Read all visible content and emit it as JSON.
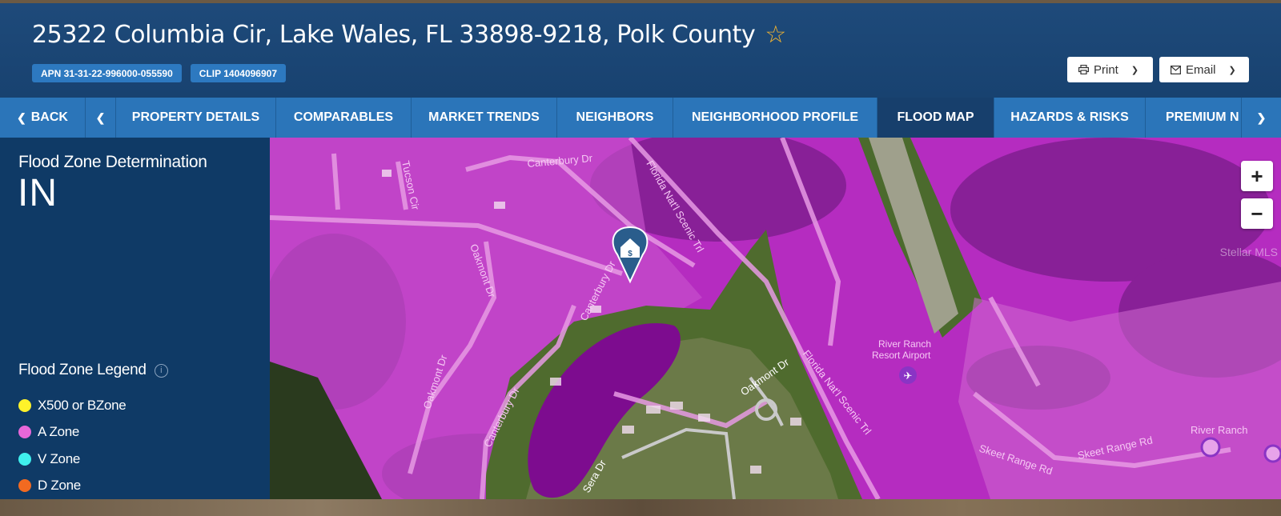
{
  "header": {
    "address": "25322 Columbia Cir, Lake Wales, FL 33898-9218, Polk County",
    "apn": "APN 31-31-22-996000-055590",
    "clip": "CLIP 1404096907",
    "print_label": "Print",
    "email_label": "Email"
  },
  "tabs": {
    "back": "BACK",
    "items": [
      "PROPERTY DETAILS",
      "COMPARABLES",
      "MARKET TRENDS",
      "NEIGHBORS",
      "NEIGHBORHOOD PROFILE",
      "FLOOD MAP",
      "HAZARDS & RISKS",
      "PREMIUM N"
    ],
    "active": "FLOOD MAP"
  },
  "sidebar": {
    "determination_title": "Flood Zone Determination",
    "determination_value": "IN",
    "legend_title": "Flood Zone Legend",
    "legend": [
      {
        "label": "X500 or BZone",
        "color": "#fff22a"
      },
      {
        "label": "A Zone",
        "color": "#e667d9"
      },
      {
        "label": "V Zone",
        "color": "#3ff0ee"
      },
      {
        "label": "D Zone",
        "color": "#f26a21"
      }
    ]
  },
  "map": {
    "zoom_in": "+",
    "zoom_out": "−",
    "watermark": "Stellar MLS",
    "labels": {
      "canterbury_top": "Canterbury Dr",
      "canterbury_mid": "Canterbury Dr",
      "canterbury_low": "Canterbury Dr",
      "tucson": "Tucson Cir",
      "florida_top": "Florida Nat'l Scenic Trl",
      "florida_low": "Florida Nat'l Scenic Trl",
      "oakmont_top": "Oakmont Dr",
      "oakmont_low": "Oakmont Dr",
      "oakmont_east": "Oakmont Dr",
      "airport": "River Ranch Resort Airport",
      "skeet1": "Skeet Range Rd",
      "skeet2": "Skeet Range Rd",
      "riverranch": "River Ranch",
      "sera": "Sera Dr"
    },
    "colors": {
      "flood_overlay": "#c22ec7",
      "flood_dark": "#8a1f96",
      "pond": "#7d0c8f",
      "pin": "#2a5d8c"
    }
  }
}
